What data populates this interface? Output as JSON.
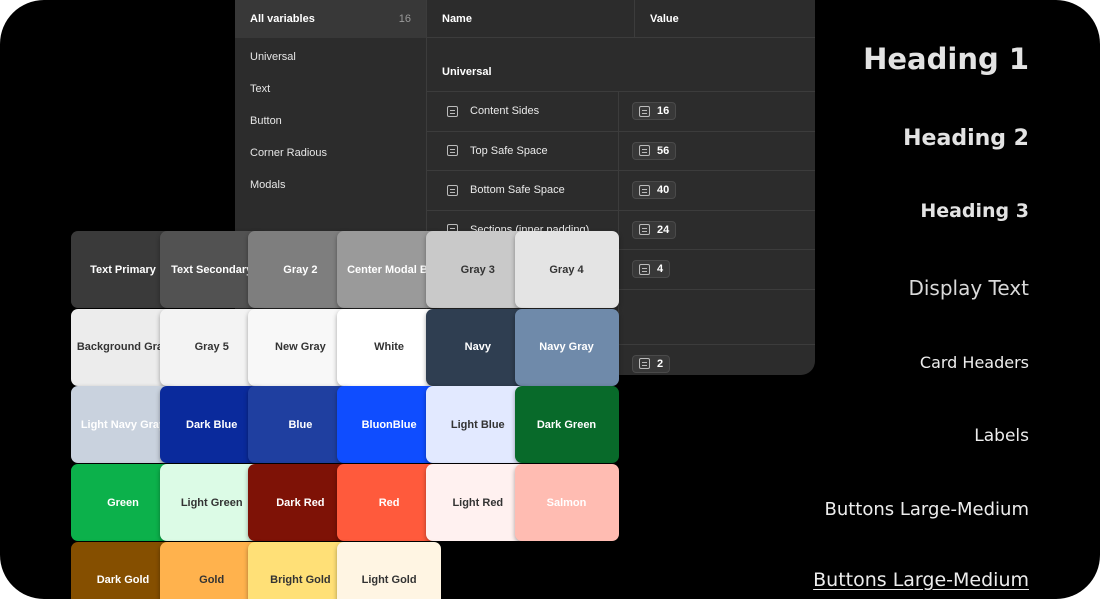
{
  "variables_panel": {
    "sidebar": {
      "title": "All variables",
      "count": "16",
      "items": [
        "Universal",
        "Text",
        "Button",
        "Corner Radious",
        "Modals"
      ]
    },
    "columns": {
      "name": "Name",
      "value": "Value"
    },
    "group": "Universal",
    "rows": [
      {
        "name": "Content Sides",
        "value": "16"
      },
      {
        "name": "Top Safe Space",
        "value": "56"
      },
      {
        "name": "Bottom Safe Space",
        "value": "40"
      },
      {
        "name": "Sections (inner padding)",
        "value": "24"
      },
      {
        "name": "",
        "value": "4"
      },
      {
        "name": "",
        "value": ""
      },
      {
        "name": "",
        "value": "2"
      }
    ]
  },
  "swatches": [
    {
      "label": "Text Primary",
      "bg": "#3a3a3a",
      "fg": "#ffffff"
    },
    {
      "label": "Text Secondary",
      "bg": "#525252",
      "fg": "#ffffff"
    },
    {
      "label": "Gray 2",
      "bg": "#7e7e7e",
      "fg": "#ffffff"
    },
    {
      "label": "Center Modal BG",
      "bg": "#9a9a9a",
      "fg": "#ffffff"
    },
    {
      "label": "Gray 3",
      "bg": "#c9c9c9",
      "fg": "#333333"
    },
    {
      "label": "Gray 4",
      "bg": "#e4e4e4",
      "fg": "#333333"
    },
    {
      "label": "Background Gray",
      "bg": "#ececec",
      "fg": "#333333"
    },
    {
      "label": "Gray 5",
      "bg": "#f3f3f3",
      "fg": "#333333"
    },
    {
      "label": "New Gray",
      "bg": "#f8f8f8",
      "fg": "#333333"
    },
    {
      "label": "White",
      "bg": "#ffffff",
      "fg": "#333333"
    },
    {
      "label": "Navy",
      "bg": "#2f3e51",
      "fg": "#ffffff"
    },
    {
      "label": "Navy Gray",
      "bg": "#6f8aaa",
      "fg": "#ffffff"
    },
    {
      "label": "Light Navy Gray",
      "bg": "#c9d2de",
      "fg": "#ffffff"
    },
    {
      "label": "Dark Blue",
      "bg": "#0a2a9c",
      "fg": "#ffffff"
    },
    {
      "label": "Blue",
      "bg": "#1f3fa0",
      "fg": "#ffffff"
    },
    {
      "label": "BluonBlue",
      "bg": "#0f4dff",
      "fg": "#ffffff"
    },
    {
      "label": "Light Blue",
      "bg": "#e2e9ff",
      "fg": "#333333"
    },
    {
      "label": "Dark Green",
      "bg": "#086a2a",
      "fg": "#ffffff"
    },
    {
      "label": "Green",
      "bg": "#0cb14b",
      "fg": "#ffffff"
    },
    {
      "label": "Light Green",
      "bg": "#dcfbe6",
      "fg": "#333333"
    },
    {
      "label": "Dark Red",
      "bg": "#7e1206",
      "fg": "#ffffff"
    },
    {
      "label": "Red",
      "bg": "#ff5a3c",
      "fg": "#ffffff"
    },
    {
      "label": "Light Red",
      "bg": "#fff1f0",
      "fg": "#333333"
    },
    {
      "label": "Salmon",
      "bg": "#ffbcb2",
      "fg": "#ffffff"
    },
    {
      "label": "Dark Gold",
      "bg": "#854f00",
      "fg": "#ffffff"
    },
    {
      "label": "Gold",
      "bg": "#ffb24d",
      "fg": "#333333"
    },
    {
      "label": "Bright Gold",
      "bg": "#ffe077",
      "fg": "#333333"
    },
    {
      "label": "Light Gold",
      "bg": "#fff5e3",
      "fg": "#333333"
    }
  ],
  "typography": [
    "Heading 1",
    "Heading 2",
    "Heading 3",
    "Display Text",
    "Card Headers",
    "Labels",
    "Buttons Large-Medium",
    "Buttons Large-Medium"
  ]
}
